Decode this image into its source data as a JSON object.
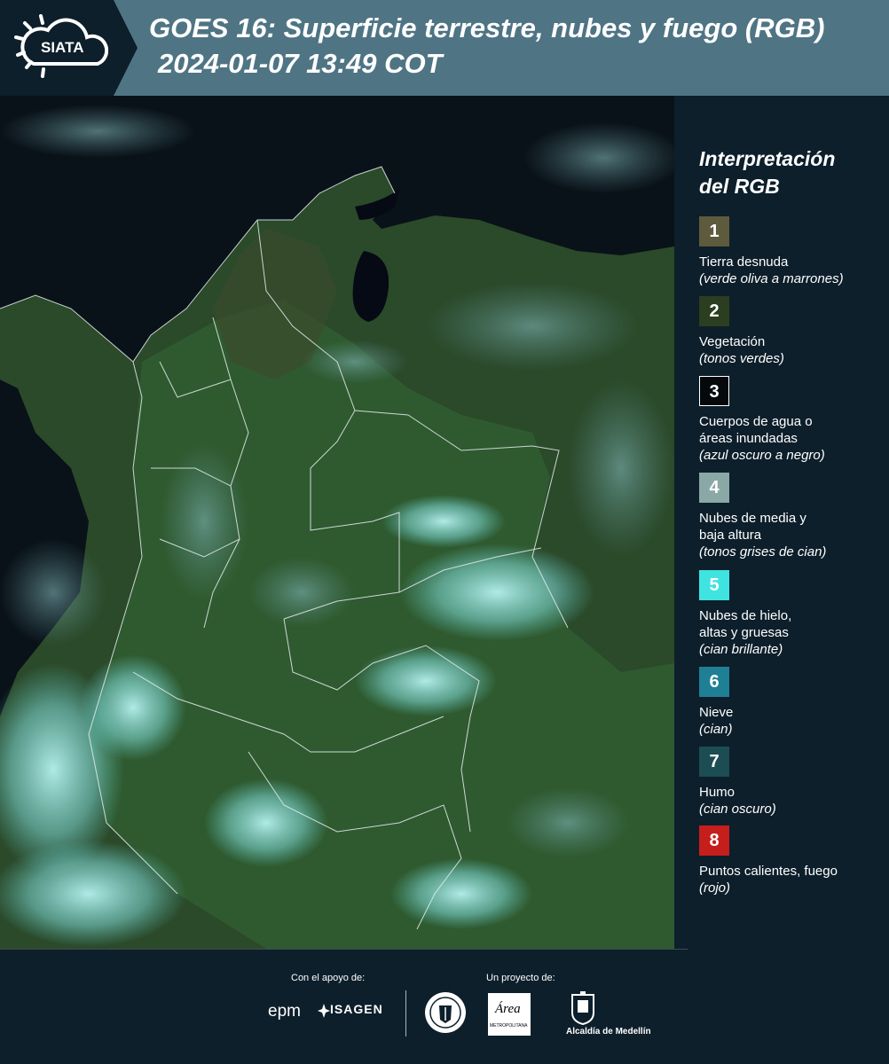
{
  "header": {
    "logo_text": "SIATA",
    "title_line1": "GOES 16: Superficie terrestre, nubes y fuego (RGB)",
    "title_line2": "2024-01-07 13:49 COT"
  },
  "legend": {
    "title_line1": "Interpretación",
    "title_line2": "del RGB",
    "items": [
      {
        "number": "1",
        "label": "Tierra desnuda",
        "label2": "",
        "note": "(verde oliva a marrones)",
        "color": "#5e5a3d"
      },
      {
        "number": "2",
        "label": "Vegetación",
        "label2": "",
        "note": "(tonos verdes)",
        "color": "#2c3e20"
      },
      {
        "number": "3",
        "label": "Cuerpos de agua o",
        "label2": "áreas inundadas",
        "note": "(azul oscuro a negro)",
        "color": "#05090c"
      },
      {
        "number": "4",
        "label": "Nubes de media y",
        "label2": "baja altura",
        "note": "(tonos grises de cian)",
        "color": "#8aa8a5"
      },
      {
        "number": "5",
        "label": "Nubes de hielo,",
        "label2": "altas y gruesas",
        "note": "(cian brillante)",
        "color": "#3fe3e0"
      },
      {
        "number": "6",
        "label": "Nieve",
        "label2": "",
        "note": "(cian)",
        "color": "#1f7f95"
      },
      {
        "number": "7",
        "label": "Humo",
        "label2": "",
        "note": "(cian oscuro)",
        "color": "#1c4d52"
      },
      {
        "number": "8",
        "label": "Puntos calientes, fuego",
        "label2": "",
        "note": "(rojo)",
        "color": "#c61d1d"
      }
    ]
  },
  "footer": {
    "support_label": "Con el apoyo de:",
    "project_label": "Un proyecto de:",
    "sponsor1": "epm",
    "sponsor2": "ISAGEN",
    "area_logo_text": "Área",
    "area_logo_subtext": "METROPOLITANA",
    "alcaldia": "Alcaldía de Medellín"
  }
}
